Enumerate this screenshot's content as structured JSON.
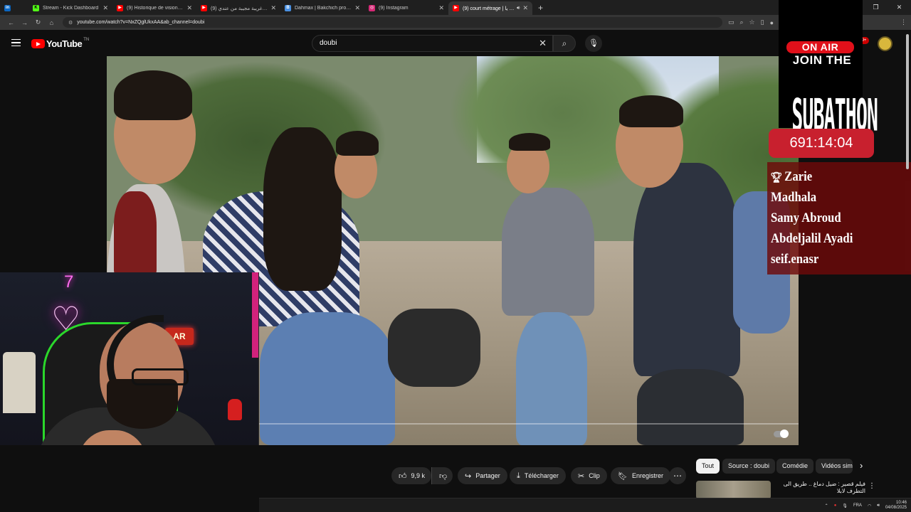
{
  "browser": {
    "tabs": [
      {
        "title": "",
        "icon": "linkedin-icon",
        "color": "#0a66c2",
        "glyph": "in"
      },
      {
        "title": "Stream - Kick Dashboard",
        "icon": "kick-icon",
        "color": "#53fc18",
        "glyph": "K"
      },
      {
        "title": "(9) Historique de visionnage - Y",
        "icon": "youtube-icon",
        "color": "#ff0000",
        "glyph": "▶"
      },
      {
        "title": "(9) حلقة غريبة مجيبة من عندي",
        "icon": "youtube-icon",
        "color": "#ff0000",
        "glyph": "▶"
      },
      {
        "title": "Dahmax | Bakchich profile | Bak",
        "icon": "generic-site-icon",
        "color": "#4a90e2",
        "glyph": "B"
      },
      {
        "title": "(9) Instagram",
        "icon": "instagram-icon",
        "color": "#d62976",
        "glyph": "◎"
      },
      {
        "title": "(9) court métrage | الديب يا",
        "icon": "youtube-icon",
        "color": "#ff0000",
        "glyph": "▶"
      }
    ],
    "new_tab": "+",
    "url": "youtube.com/watch?v=NxZQglUkxAA&ab_channel=doubi"
  },
  "youtube": {
    "logo_text": "YouTube",
    "region": "TN",
    "search_query": "doubi",
    "notification_count": "9+"
  },
  "overlay": {
    "on_air": "ON AIR",
    "join": "JOIN THE",
    "subathon": "SUBATHON",
    "timer": "691:14:04",
    "supporters": [
      "Zarie",
      "Madhala",
      "Samy Abroud",
      "Abdeljalil Ayadi",
      "seif.enasr"
    ]
  },
  "webcam": {
    "sign_text": "AR"
  },
  "actions": {
    "likes": "9,9 k",
    "share": "Partager",
    "download": "Télécharger",
    "clip": "Clip",
    "save": "Enregistrer"
  },
  "chips": [
    "Tout",
    "Source : doubi",
    "Comédie",
    "Vidéos sim"
  ],
  "recommendation": {
    "title": "فيلم قصير : ضيل دماغ .. طريق الى التطرف لابلا"
  },
  "taskbar": {
    "lang": "FRA",
    "time": "10:46",
    "date": "04/08/2025"
  }
}
